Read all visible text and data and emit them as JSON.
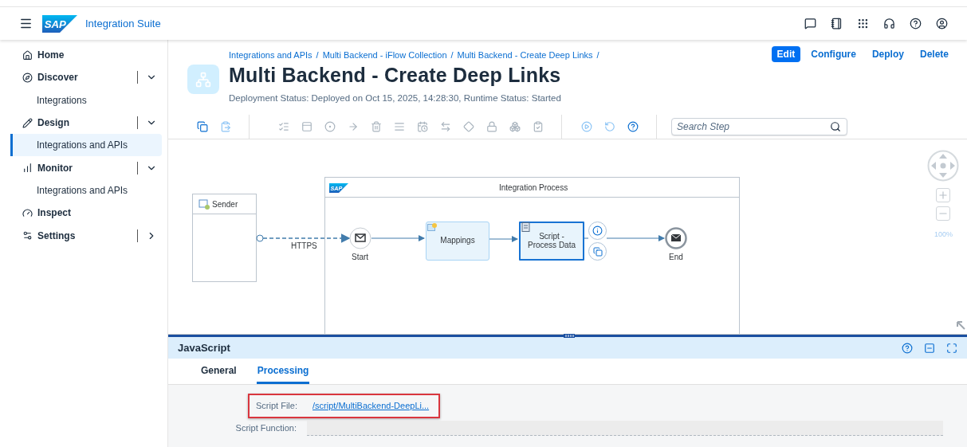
{
  "header": {
    "logo": "SAP",
    "product": "Integration Suite"
  },
  "sidebar": {
    "items": [
      {
        "label": "Home",
        "kind": "link",
        "selected": false
      },
      {
        "label": "Discover",
        "kind": "group",
        "expanded": true,
        "selected": false
      },
      {
        "label": "Integrations",
        "kind": "sub",
        "selected": false
      },
      {
        "label": "Design",
        "kind": "group",
        "expanded": true,
        "selected": false
      },
      {
        "label": "Integrations and APIs",
        "kind": "sub",
        "selected": true
      },
      {
        "label": "Monitor",
        "kind": "group",
        "expanded": true,
        "selected": false
      },
      {
        "label": "Integrations and APIs",
        "kind": "sub",
        "selected": false
      },
      {
        "label": "Inspect",
        "kind": "link",
        "selected": false
      },
      {
        "label": "Settings",
        "kind": "group",
        "expanded": false,
        "selected": false
      }
    ]
  },
  "breadcrumbs": [
    {
      "label": "Integrations and APIs",
      "separator": "/"
    },
    {
      "label": "Multi Backend - iFlow Collection",
      "separator": "/"
    },
    {
      "label": "Multi Backend - Create Deep Links",
      "separator": "/"
    }
  ],
  "actions": [
    {
      "label": "Edit",
      "kind": "emphasized"
    },
    {
      "label": "Configure",
      "kind": "transparent"
    },
    {
      "label": "Deploy",
      "kind": "transparent"
    },
    {
      "label": "Delete",
      "kind": "transparent"
    }
  ],
  "title": "Multi Backend - Create Deep Links",
  "status": "Deployment Status: Deployed on Oct 15, 2025, 14:28:30, Runtime Status: Started",
  "toolbar": {
    "tools": [
      {
        "disabled": false
      },
      {
        "disabled": true
      },
      {
        "disabled": true
      },
      {
        "disabled": true
      },
      {
        "disabled": true
      },
      {
        "disabled": true
      },
      {
        "disabled": true
      },
      {
        "disabled": true
      },
      {
        "disabled": true
      },
      {
        "disabled": true
      },
      {
        "disabled": true
      },
      {
        "disabled": true
      },
      {
        "disabled": true
      },
      {
        "disabled": true
      },
      {
        "disabled": true
      },
      {
        "disabled": true
      },
      {
        "disabled": false
      }
    ],
    "search": {
      "placeholder": "Search Step"
    }
  },
  "diagram": {
    "sender": "Sender",
    "pool": {
      "logo": "SAP",
      "title": "Integration Process"
    },
    "connection": "HTTPS",
    "start": "Start",
    "end": "End",
    "steps": [
      {
        "label": "Mappings",
        "selected": false
      },
      {
        "label": "Script - Process Data",
        "selected": true
      }
    ],
    "zoom": "100%"
  },
  "panel": {
    "title": "JavaScript",
    "tabs": [
      {
        "label": "General",
        "selected": false
      },
      {
        "label": "Processing",
        "selected": true
      }
    ],
    "fields": [
      {
        "label": "Script File:",
        "value": "/script/MultiBackend-DeepLi...",
        "kind": "link",
        "highlighted": true
      },
      {
        "label": "Script Function:",
        "kind": "input",
        "highlighted": false
      }
    ]
  }
}
